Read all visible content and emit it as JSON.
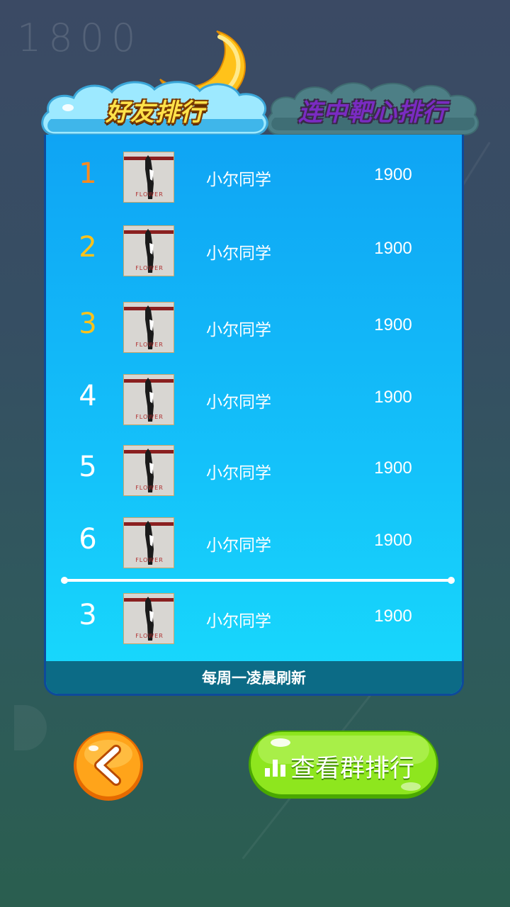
{
  "background_score": "1800",
  "tabs": {
    "friends_label": "好友排行",
    "streak_label": "连中靶心排行",
    "active": "friends"
  },
  "leaderboard": {
    "rows": [
      {
        "rank": "1",
        "name": "小尔同学",
        "score": "1900"
      },
      {
        "rank": "2",
        "name": "小尔同学",
        "score": "1900"
      },
      {
        "rank": "3",
        "name": "小尔同学",
        "score": "1900"
      },
      {
        "rank": "4",
        "name": "小尔同学",
        "score": "1900"
      },
      {
        "rank": "5",
        "name": "小尔同学",
        "score": "1900"
      },
      {
        "rank": "6",
        "name": "小尔同学",
        "score": "1900"
      }
    ],
    "self_row": {
      "rank": "3",
      "name": "小尔同学",
      "score": "1900"
    },
    "footer_note": "每周一凌晨刷新",
    "avatar_caption": "FLOWER"
  },
  "buttons": {
    "back_icon": "chevron-left-icon",
    "group_rank_label": "查看群排行",
    "group_rank_icon": "bar-chart-icon"
  },
  "colors": {
    "rank1": "#ff8a1e",
    "rank2_3": "#ffc21a",
    "panel": "#14c2fa",
    "group_button": "#8ee61e",
    "back_button": "#ff9a12"
  }
}
